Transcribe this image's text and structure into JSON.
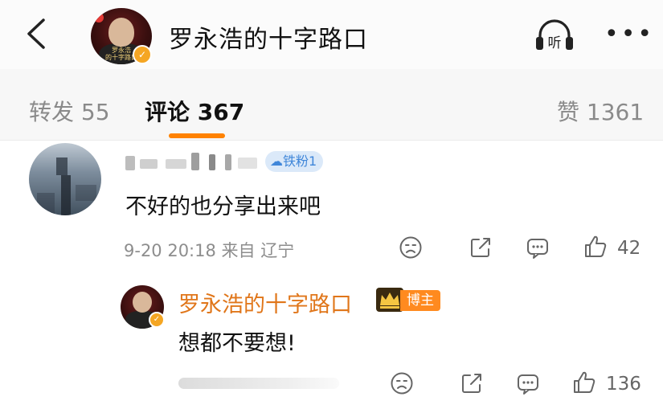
{
  "header": {
    "title": "罗永浩的十字路口",
    "avatar_caption": "罗永浩\n的十字路口",
    "verified_mark": "✓",
    "listen_label": "听",
    "more_label": "•••"
  },
  "tabs": [
    {
      "label": "转发 55",
      "active": false
    },
    {
      "label": "评论 367",
      "active": true
    },
    {
      "label": "赞 1361",
      "active": false
    }
  ],
  "comment": {
    "fan_badge": "铁粉1",
    "text": "不好的也分享出来吧",
    "meta": "9-20 20:18 来自 辽宁",
    "like_count": "42"
  },
  "reply": {
    "author": "罗永浩的十字路口",
    "author_badge": "博主",
    "verified_mark": "✓",
    "text": "想都不要想!",
    "like_count": "136"
  },
  "colors": {
    "accent": "#ff8200",
    "author_name": "#e0761a",
    "fan_badge_bg": "#dbe9f9",
    "fan_badge_text": "#3f86d9"
  }
}
